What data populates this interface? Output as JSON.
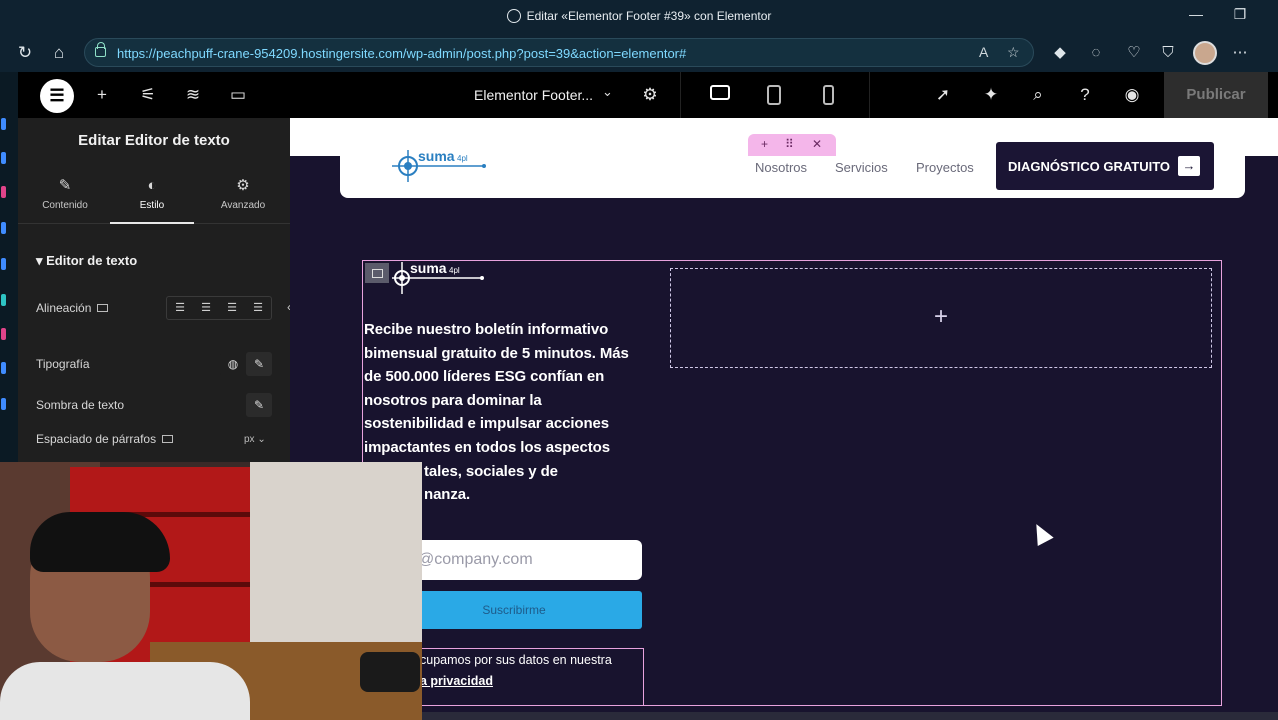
{
  "browser": {
    "window_title": "Editar «Elementor Footer #39» con Elementor",
    "url": "https://peachpuff-crane-954209.hostingersite.com/wp-admin/post.php?post=39&action=elementor#",
    "minimize": "—",
    "restore": "❐"
  },
  "topbar": {
    "document_title": "Elementor Footer...",
    "publish_label": "Publicar"
  },
  "panel": {
    "title": "Editar Editor de texto",
    "tabs": [
      {
        "label": "Contenido",
        "icon": "pencil-icon"
      },
      {
        "label": "Estilo",
        "icon": "contrast-icon"
      },
      {
        "label": "Avanzado",
        "icon": "gear-icon"
      }
    ],
    "section_title": "Editor de texto",
    "rows": {
      "alignment": "Alineación",
      "typography": "Tipografía",
      "text_shadow": "Sombra de texto",
      "paragraph_spacing": "Espaciado de párrafos",
      "unit": "px"
    }
  },
  "site": {
    "logo_text": "suma",
    "logo_sub": "4pl",
    "nav": [
      "Nosotros",
      "Servicios",
      "Proyectos"
    ],
    "cta_label": "DIAGNÓSTICO GRATUITO",
    "footer_paragraph_lines": [
      "Recibe nuestro boletín informativo",
      "bimensual gratuito de 5 minutos. Más",
      "de 500.000 líderes ESG confían en",
      "nosotros para dominar la",
      "sostenibilidad e impulsar acciones",
      "impactantes en todos los aspectos",
      "tales, sociales y de",
      "nanza."
    ],
    "email_placeholder": "@company.com",
    "subscribe_label": "Suscribirme",
    "privacy_line1": "cupamos por sus datos en nuestra",
    "privacy_line2": "a privacidad"
  }
}
